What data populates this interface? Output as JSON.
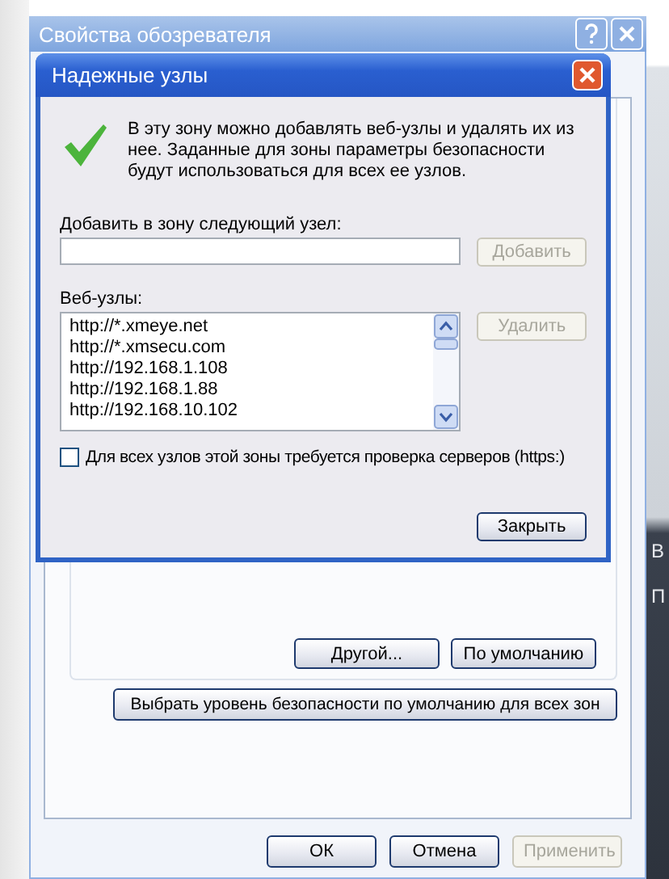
{
  "background_window": {
    "title": "Свойства обозревателя",
    "zone_buttons": [
      {
        "label": "Другой...",
        "disabled": false
      },
      {
        "label": "По умолчанию",
        "disabled": false
      }
    ],
    "reset_all_button": {
      "label": "Выбрать уровень безопасности по умолчанию для всех зон",
      "disabled": false
    },
    "dialog_buttons": [
      {
        "label": "ОК",
        "disabled": false
      },
      {
        "label": "Отмена",
        "disabled": false
      },
      {
        "label": "Применить",
        "disabled": true
      }
    ],
    "side_texts": [
      "В",
      "П"
    ]
  },
  "dialog": {
    "title": "Надежные узлы",
    "info": "В эту зону можно добавлять веб-узлы и удалять их из нее. Заданные для зоны параметры безопасности будут использоваться для всех ее узлов.",
    "add_label": "Добавить в зону следующий узел:",
    "add_button": {
      "label": "Добавить",
      "disabled": true
    },
    "sites_label": "Веб-узлы:",
    "sites": [
      "http://*.xmeye.net",
      "http://*.xmsecu.com",
      "http://192.168.1.108",
      "http://192.168.1.88",
      "http://192.168.10.102"
    ],
    "remove_button": {
      "label": "Удалить",
      "disabled": true
    },
    "https_check": {
      "label": "Для всех узлов этой зоны требуется проверка серверов (https:)",
      "checked": false
    },
    "close_button": {
      "label": "Закрыть",
      "disabled": false
    }
  }
}
